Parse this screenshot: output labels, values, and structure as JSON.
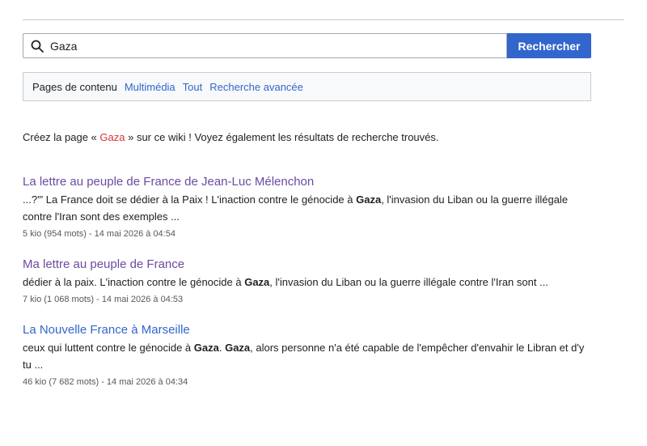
{
  "search": {
    "query": "Gaza",
    "button_label": "Rechercher"
  },
  "profiles": {
    "current": "Pages de contenu",
    "links": [
      "Multimédia",
      "Tout",
      "Recherche avancée"
    ]
  },
  "create_notice": {
    "prefix": "Créez la page « ",
    "page_link": "Gaza",
    "suffix": " » sur ce wiki ! Voyez également les résultats de recherche trouvés."
  },
  "results": [
    {
      "title": "La lettre au peuple de France de Jean-Luc Mélenchon",
      "visited": true,
      "snippet": [
        "...?'\" La France doit se dédier à la Paix ! L'inaction contre le génocide à ",
        {
          "b": "Gaza"
        },
        ", l'invasion du Liban ou la guerre illégale contre l'Iran sont des exemples ..."
      ],
      "meta": "5 kio (954 mots) - 14 mai 2026 à 04:54"
    },
    {
      "title": "Ma lettre au peuple de France",
      "visited": true,
      "snippet": [
        "dédier à la paix. L'inaction contre le génocide à ",
        {
          "b": "Gaza"
        },
        ", l'invasion du Liban ou la guerre illégale contre l'Iran sont ..."
      ],
      "meta": "7 kio (1 068 mots) - 14 mai 2026 à 04:53"
    },
    {
      "title": "La Nouvelle France à Marseille",
      "visited": false,
      "snippet": [
        "ceux qui luttent contre le génocide à ",
        {
          "b": "Gaza"
        },
        ". ",
        {
          "b": "Gaza"
        },
        ", alors personne n'a été capable de l'empêcher d'envahir le Libran et d'y tu ..."
      ],
      "meta": "46 kio (7 682 mots) - 14 mai 2026 à 04:34"
    }
  ]
}
